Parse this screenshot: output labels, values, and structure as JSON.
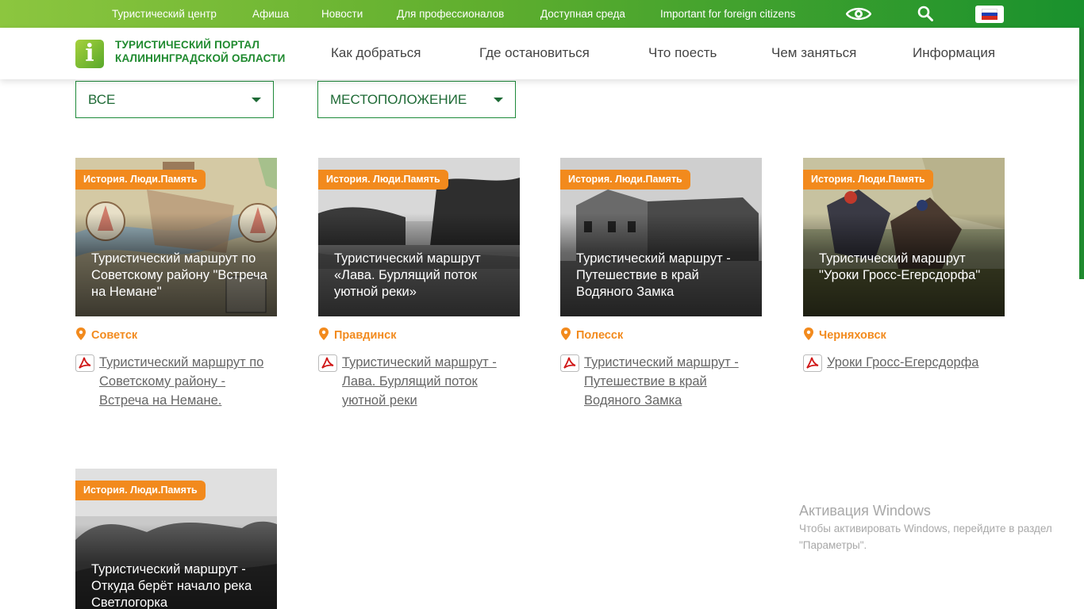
{
  "topbar": {
    "links": [
      "Туристический центр",
      "Афиша",
      "Новости",
      "Для профессионалов",
      "Доступная среда",
      "Important for foreign citizens"
    ],
    "icons": [
      "eye-icon",
      "search-icon",
      "russian-flag-icon"
    ]
  },
  "header": {
    "logo_letter": "i",
    "logo_line1": "ТУРИСТИЧЕСКИЙ ПОРТАЛ",
    "logo_line2": "КАЛИНИНГРАДСКОЙ ОБЛАСТИ",
    "nav": [
      "Как добраться",
      "Где остановиться",
      "Что поесть",
      "Чем заняться",
      "Информация"
    ]
  },
  "filters": {
    "category": "ВСЕ",
    "location": "МЕСТОПОЛОЖЕНИЕ"
  },
  "cards": [
    {
      "tag": "История. Люди.Память",
      "title": "Туристический маршрут по Советскому району \"Встреча на Немане\"",
      "location": "Советск",
      "doc": "Туристический маршрут по Советскому району - Встреча на Немане."
    },
    {
      "tag": "История. Люди.Память",
      "title": "Туристический маршрут «Лава. Бурлящий поток уютной реки»",
      "location": "Правдинск",
      "doc": "Туристический маршрут - Лава. Бурлящий поток уютной реки"
    },
    {
      "tag": "История. Люди.Память",
      "title": "Туристический маршрут - Путешествие в край Водяного Замка",
      "location": "Полесск",
      "doc": "Туристический маршрут - Путешествие в край Водяного Замка"
    },
    {
      "tag": "История. Люди.Память",
      "title": "Туристический маршрут \"Уроки Гросс-Егерсдорфа\"",
      "location": "Черняховск",
      "doc": "Уроки Гросс-Егерсдорфа"
    },
    {
      "tag": "История. Люди.Память",
      "title": "Туристический маршрут - Откуда берёт начало река Светлогорка",
      "location": "",
      "doc": ""
    }
  ],
  "watermark": {
    "title": "Активация Windows",
    "text": "Чтобы активировать Windows, перейдите в раздел \"Параметры\"."
  },
  "colors": {
    "brand_green": "#1f8a2f",
    "accent_orange": "#f28a1d"
  }
}
